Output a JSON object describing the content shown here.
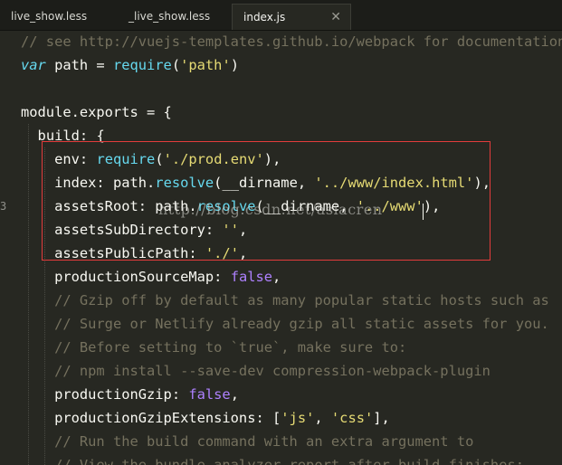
{
  "tabs": [
    {
      "label": "live_show.less",
      "active": false
    },
    {
      "label": "_live_show.less",
      "active": false
    },
    {
      "label": "index.js",
      "active": true,
      "close": "✕"
    }
  ],
  "gutter_marker": "3",
  "watermark": "http://blog.csdn.net/asiacren",
  "colors": {
    "background": "#272822",
    "comment": "#75715e",
    "keyword": "#66d9ef",
    "string": "#e6db74",
    "number_bool": "#ae81ff",
    "highlight_box": "#e23c3c"
  },
  "code_lines": [
    "// see http://vuejs-templates.github.io/webpack for documentation.",
    "var path = require('path')",
    "",
    "module.exports = {",
    "  build: {",
    "    env: require('./prod.env'),",
    "    index: path.resolve(__dirname, '../www/index.html'),",
    "    assetsRoot: path.resolve(__dirname, '../www'),",
    "    assetsSubDirectory: '',",
    "    assetsPublicPath: './',",
    "    productionSourceMap: false,",
    "    // Gzip off by default as many popular static hosts such as",
    "    // Surge or Netlify already gzip all static assets for you.",
    "    // Before setting to `true`, make sure to:",
    "    // npm install --save-dev compression-webpack-plugin",
    "    productionGzip: false,",
    "    productionGzipExtensions: ['js', 'css'],",
    "    // Run the build command with an extra argument to",
    "    // View the bundle analyzer report after build finishes:"
  ]
}
